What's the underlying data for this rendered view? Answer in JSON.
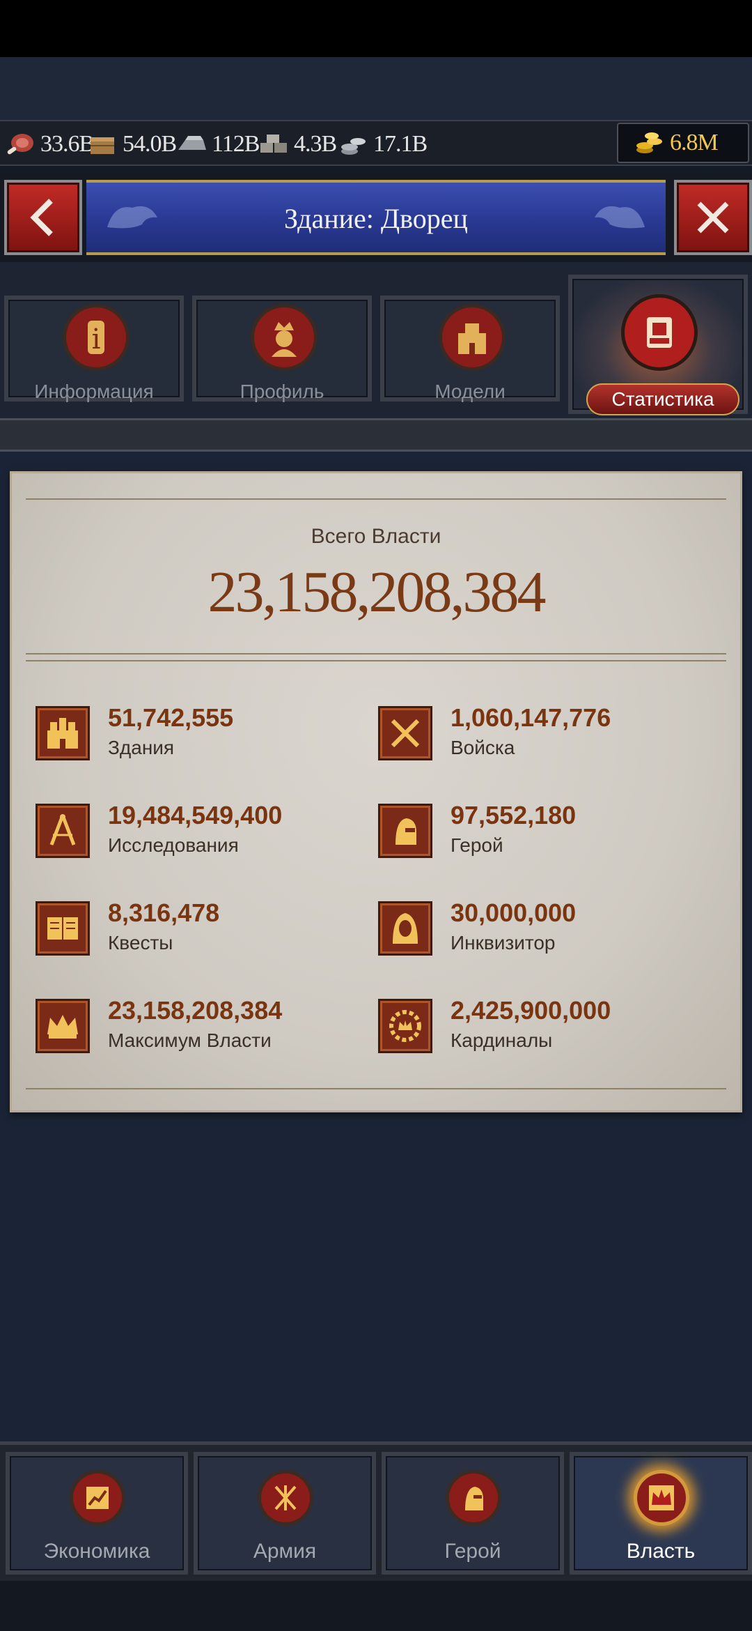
{
  "resources": {
    "meat": "33.6B",
    "wood": "54.0B",
    "iron": "112B",
    "stone": "4.3B",
    "silver": "17.1B",
    "gold": "6.8M"
  },
  "header": {
    "title": "Здание: Дворец"
  },
  "tabs": [
    {
      "label": "Информация"
    },
    {
      "label": "Профиль"
    },
    {
      "label": "Модели"
    },
    {
      "label": "Статистика"
    }
  ],
  "summary": {
    "total_label": "Всего Власти",
    "total_value": "23,158,208,384"
  },
  "stats": [
    {
      "value": "51,742,555",
      "label": "Здания",
      "icon": "buildings-icon"
    },
    {
      "value": "1,060,147,776",
      "label": "Войска",
      "icon": "crossed-swords-icon"
    },
    {
      "value": "19,484,549,400",
      "label": "Исследования",
      "icon": "compass-icon"
    },
    {
      "value": "97,552,180",
      "label": "Герой",
      "icon": "knight-helmet-icon"
    },
    {
      "value": "8,316,478",
      "label": "Квесты",
      "icon": "open-book-icon"
    },
    {
      "value": "30,000,000",
      "label": "Инквизитор",
      "icon": "hooded-figure-icon"
    },
    {
      "value": "23,158,208,384",
      "label": "Максимум Власти",
      "icon": "crown-icon"
    },
    {
      "value": "2,425,900,000",
      "label": "Кардиналы",
      "icon": "cardinal-emblem-icon"
    }
  ],
  "bottom_nav": [
    {
      "label": "Экономика"
    },
    {
      "label": "Армия"
    },
    {
      "label": "Герой"
    },
    {
      "label": "Власть"
    }
  ],
  "colors": {
    "accent_red": "#b01f1d",
    "gold": "#f2c94c",
    "stat_value": "#7a3410",
    "banner_blue": "#2a3a95"
  }
}
